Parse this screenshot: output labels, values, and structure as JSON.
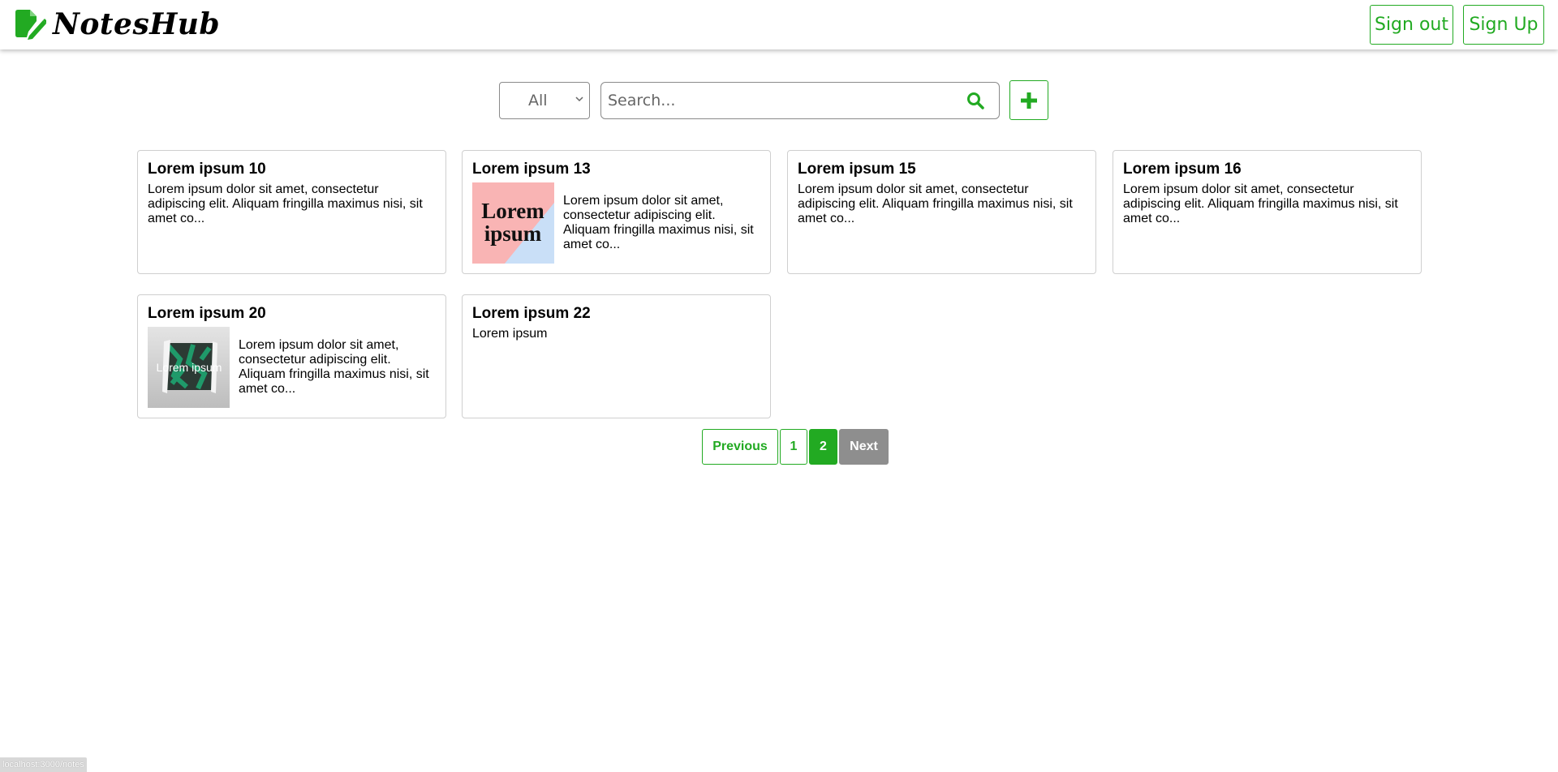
{
  "header": {
    "brand": "NotesHub",
    "sign_out_label": "Sign out",
    "sign_up_label": "Sign Up",
    "accent_color": "#22aa22"
  },
  "toolbar": {
    "filter_value": "All",
    "search_placeholder": "Search...",
    "add_icon": "plus-icon",
    "search_icon": "search-icon"
  },
  "notes": [
    {
      "title": "Lorem ipsum 10",
      "text": "Lorem ipsum dolor sit amet, consectetur adipiscing elit. Aliquam fringilla maximus nisi, sit amet co..."
    },
    {
      "title": "Lorem ipsum 13",
      "text": "Lorem ipsum dolor sit amet, consectetur adipiscing elit. Aliquam fringilla maximus nisi, sit amet co...",
      "image_text": "Lorem ipsum"
    },
    {
      "title": "Lorem ipsum 15",
      "text": "Lorem ipsum dolor sit amet, consectetur adipiscing elit. Aliquam fringilla maximus nisi, sit amet co..."
    },
    {
      "title": "Lorem ipsum 16",
      "text": "Lorem ipsum dolor sit amet, consectetur adipiscing elit. Aliquam fringilla maximus nisi, sit amet co..."
    },
    {
      "title": "Lorem ipsum 20",
      "text": "Lorem ipsum dolor sit amet, consectetur adipiscing elit. Aliquam fringilla maximus nisi, sit amet co...",
      "image_text": "Lorem ipsum"
    },
    {
      "title": "Lorem ipsum 22",
      "text": "Lorem ipsum"
    }
  ],
  "pagination": {
    "previous_label": "Previous",
    "pages": [
      "1",
      "2"
    ],
    "current_page": "2",
    "next_label": "Next"
  },
  "status_bar": {
    "url": "localhost:3000/notes"
  }
}
